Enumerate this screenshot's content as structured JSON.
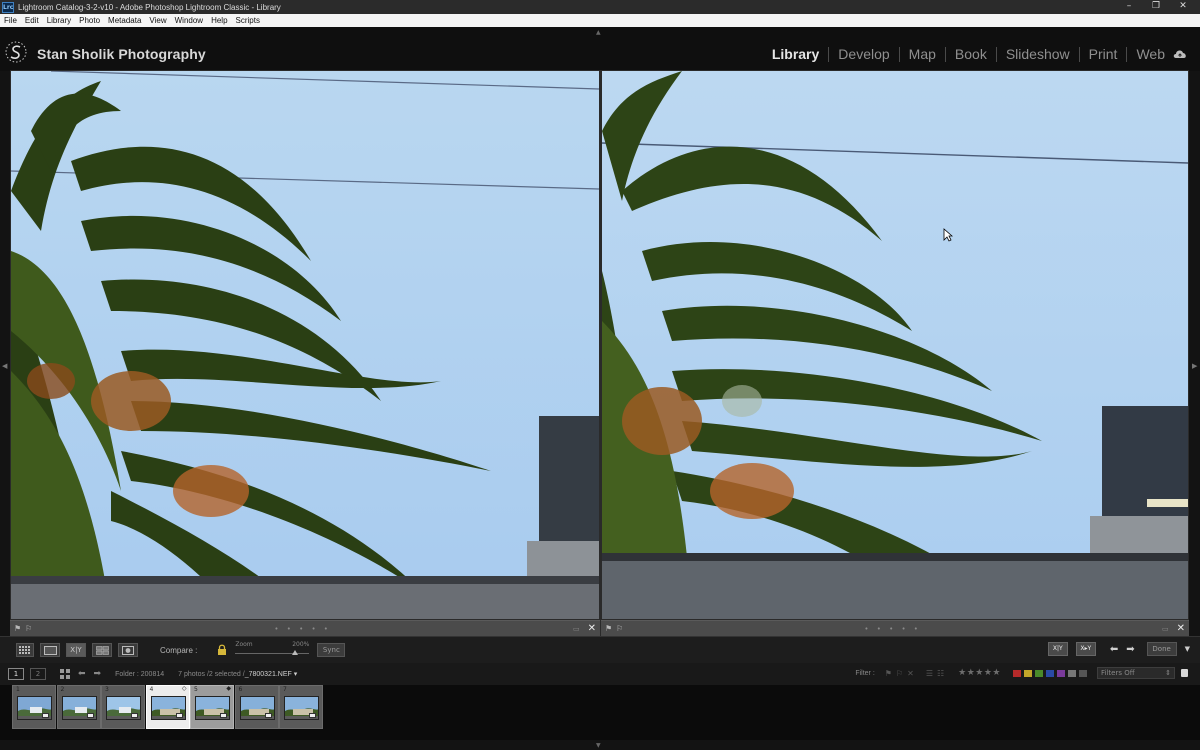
{
  "window": {
    "app_icon": "Lrc",
    "title": "Lightroom Catalog-3-2-v10 - Adobe Photoshop Lightroom Classic - Library",
    "controls": [
      "minimize-icon",
      "restore-icon",
      "close-icon"
    ]
  },
  "menubar": [
    "File",
    "Edit",
    "Library",
    "Photo",
    "Metadata",
    "View",
    "Window",
    "Help",
    "Scripts"
  ],
  "identity_plate": "Stan Sholik Photography",
  "modules": [
    {
      "label": "Library",
      "active": true
    },
    {
      "label": "Develop",
      "active": false
    },
    {
      "label": "Map",
      "active": false
    },
    {
      "label": "Book",
      "active": false
    },
    {
      "label": "Slideshow",
      "active": false
    },
    {
      "label": "Print",
      "active": false
    },
    {
      "label": "Web",
      "active": false
    }
  ],
  "compare": {
    "left_pane": {
      "role": "select",
      "dots": "• • • • •"
    },
    "right_pane": {
      "role": "candidate",
      "dots": "• • • • •"
    },
    "close_glyph": "✕"
  },
  "toolbar": {
    "compare_label": "Compare :",
    "zoom_label": "Zoom",
    "zoom_value": "200%",
    "zoom_level": 0.8,
    "sync_label": "Sync",
    "done_label": "Done",
    "view_buttons": [
      "grid-view",
      "loupe-view",
      "compare-view",
      "survey-view",
      "people-view"
    ],
    "compare_glyph": "X|Y",
    "swap_glyph": "X|Y",
    "make_select_glyph": "X▸Y"
  },
  "filmstrip_header": {
    "screen_primary": "1",
    "screen_secondary": "2",
    "folder": "Folder : 200814",
    "selection": "7 photos /2 selected /",
    "filename": "_7800321.NEF ▾",
    "filter_label": "Filter :",
    "stars": "★★★★★",
    "filters_value": "Filters Off",
    "label_colors": [
      "#b52a2a",
      "#c2a52a",
      "#4a8a2a",
      "#2a4aa5",
      "#7a3a9a",
      "#777777",
      "#555555"
    ]
  },
  "filmstrip": [
    {
      "num": "1",
      "state": "normal"
    },
    {
      "num": "2",
      "state": "normal"
    },
    {
      "num": "3",
      "state": "normal"
    },
    {
      "num": "4",
      "state": "active"
    },
    {
      "num": "5",
      "state": "selected"
    },
    {
      "num": "6",
      "state": "normal"
    },
    {
      "num": "7",
      "state": "normal"
    }
  ]
}
